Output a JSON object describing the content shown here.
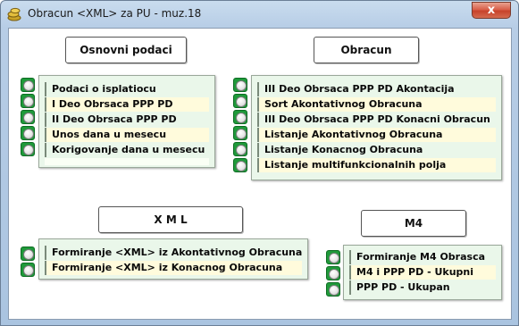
{
  "window": {
    "title": "Obracun <XML> za PU - muz.18",
    "close_label": "x"
  },
  "sections": {
    "osnovni": {
      "header": "Osnovni podaci",
      "items": [
        "Podaci o isplatiocu",
        "I Deo Obrsaca PPP PD",
        "II Deo Obrsaca PPP PD",
        "Unos dana u mesecu",
        "Korigovanje dana u mesecu"
      ]
    },
    "obracun": {
      "header": "Obracun",
      "items": [
        "III Deo Obrsaca PPP PD Akontacija",
        "Sort Akontativnog Obracuna",
        "III Deo Obrsaca PPP PD Konacni Obracun",
        "Listanje Akontativnog Obracuna",
        "Listanje Konacnog Obracuna",
        "Listanje multifunkcionalnih polja"
      ]
    },
    "xml": {
      "header": "X M L",
      "items": [
        "Formiranje <XML> iz Akontativnog Obracuna",
        "Formiranje <XML> iz Konacnog Obracuna"
      ]
    },
    "m4": {
      "header": "M4",
      "items": [
        "Formiranje M4 Obrasca",
        "M4 i PPP PD - Ukupni",
        "PPP PD - Ukupan"
      ]
    }
  }
}
